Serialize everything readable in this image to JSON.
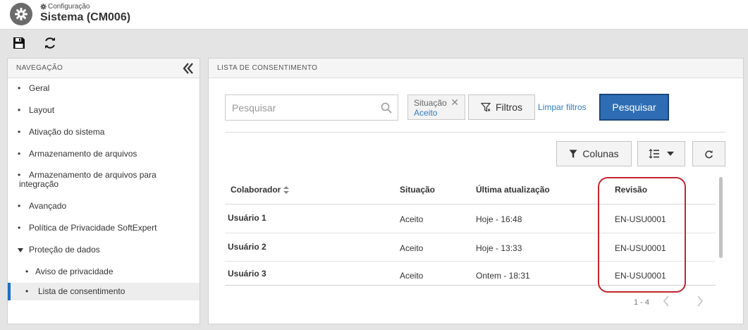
{
  "header": {
    "breadcrumb": "Configuração",
    "title": "Sistema (CM006)"
  },
  "toolbar": {
    "save_icon": "save-icon",
    "refresh_icon": "refresh-icon"
  },
  "navigation": {
    "heading": "NAVEGAÇÃO",
    "items": [
      {
        "label": "Geral"
      },
      {
        "label": "Layout"
      },
      {
        "label": "Ativação do sistema"
      },
      {
        "label": "Armazenamento de arquivos"
      },
      {
        "label": "Armazenamento de arquivos para integração"
      },
      {
        "label": "Avançado"
      },
      {
        "label": "Política de Privacidade SoftExpert"
      },
      {
        "label": "Proteção de dados",
        "expanded": true
      },
      {
        "label": "Aviso de privacidade"
      },
      {
        "label": "Lista de consentimento",
        "selected": true
      }
    ]
  },
  "main": {
    "heading": "LISTA DE CONSENTIMENTO",
    "search_placeholder": "Pesquisar",
    "filter_chip": {
      "label": "Situação",
      "value": "Aceito"
    },
    "filters_label": "Filtros",
    "clear_filters_label": "Limpar filtros",
    "search_button_label": "Pesquisar",
    "columns_label": "Colunas",
    "table": {
      "headers": [
        "Colaborador",
        "Situação",
        "Última atualização",
        "Revisão"
      ],
      "rows": [
        [
          "Usuário 1",
          "Aceito",
          "Hoje - 16:48",
          "EN-USU0001"
        ],
        [
          "Usuário 2",
          "Aceito",
          "Hoje - 13:33",
          "EN-USU0001"
        ],
        [
          "Usuário 3",
          "Aceito",
          "Ontem - 18:31",
          "EN-USU0001"
        ]
      ]
    },
    "pagination": {
      "range": "1 - 4"
    }
  },
  "colors": {
    "accent": "#2e6db4",
    "link": "#2f7cc1",
    "highlight": "#c0262e",
    "nav_selected": "#1a6fc4"
  }
}
